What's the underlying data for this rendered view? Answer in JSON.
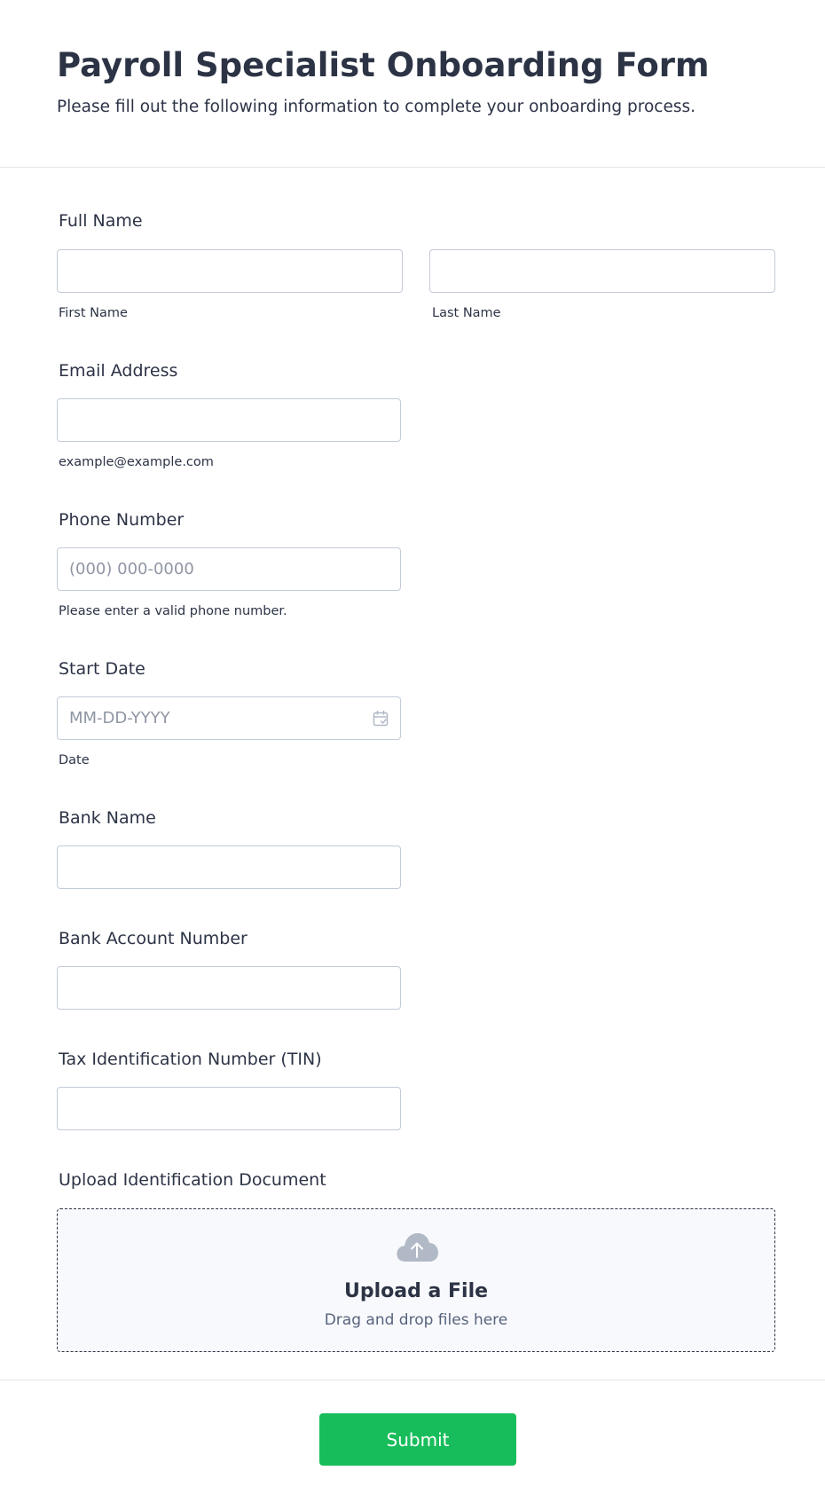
{
  "header": {
    "title": "Payroll Specialist Onboarding Form",
    "subtitle": "Please fill out the following information to complete your onboarding process."
  },
  "fields": {
    "full_name": {
      "label": "Full Name",
      "first": {
        "value": "",
        "sublabel": "First Name"
      },
      "last": {
        "value": "",
        "sublabel": "Last Name"
      }
    },
    "email": {
      "label": "Email Address",
      "value": "",
      "sublabel": "example@example.com"
    },
    "phone": {
      "label": "Phone Number",
      "value": "",
      "placeholder": "(000) 000-0000",
      "sublabel": "Please enter a valid phone number."
    },
    "start_date": {
      "label": "Start Date",
      "value": "",
      "placeholder": "MM-DD-YYYY",
      "sublabel": "Date",
      "icon": "calendar-icon"
    },
    "bank_name": {
      "label": "Bank Name",
      "value": ""
    },
    "bank_account": {
      "label": "Bank Account Number",
      "value": ""
    },
    "tin": {
      "label": "Tax Identification Number (TIN)",
      "value": ""
    },
    "upload": {
      "label": "Upload Identification Document",
      "title": "Upload a File",
      "hint": "Drag and drop files here",
      "icon": "cloud-upload-icon"
    }
  },
  "submit": {
    "label": "Submit"
  },
  "colors": {
    "text": "#2c3345",
    "border": "#c3cad8",
    "placeholder": "#8f96a3",
    "submit_bg": "#18bd5b",
    "upload_bg": "#f8f9fc",
    "icon_gray": "#b1b9c7"
  }
}
